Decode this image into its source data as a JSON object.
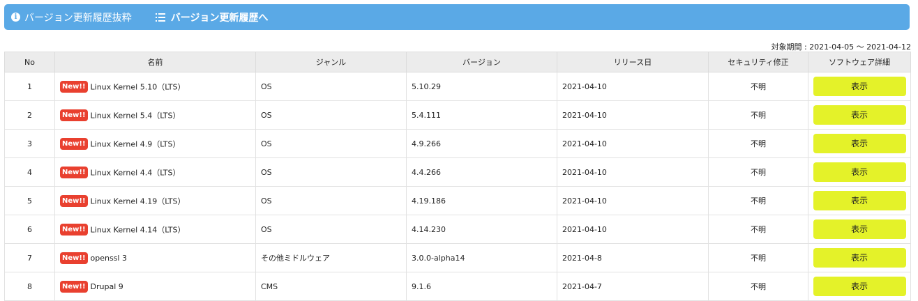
{
  "topbar": {
    "item1": "バージョン更新履歴抜粋",
    "item2": "バージョン更新履歴へ"
  },
  "period": "対象期間 : 2021-04-05 〜 2021-04-12",
  "table": {
    "headers": [
      "No",
      "名前",
      "ジャンル",
      "バージョン",
      "リリース日",
      "セキュリティ修正",
      "ソフトウェア詳細"
    ],
    "rows": [
      {
        "no": "1",
        "badge": "New!!",
        "name": "Linux Kernel 5.10（LTS）",
        "genre": "OS",
        "version": "5.10.29",
        "date": "2021-04-10",
        "security": "不明",
        "button": "表示"
      },
      {
        "no": "2",
        "badge": "New!!",
        "name": "Linux Kernel 5.4（LTS）",
        "genre": "OS",
        "version": "5.4.111",
        "date": "2021-04-10",
        "security": "不明",
        "button": "表示"
      },
      {
        "no": "3",
        "badge": "New!!",
        "name": "Linux Kernel 4.9（LTS）",
        "genre": "OS",
        "version": "4.9.266",
        "date": "2021-04-10",
        "security": "不明",
        "button": "表示"
      },
      {
        "no": "4",
        "badge": "New!!",
        "name": "Linux Kernel 4.4（LTS）",
        "genre": "OS",
        "version": "4.4.266",
        "date": "2021-04-10",
        "security": "不明",
        "button": "表示"
      },
      {
        "no": "5",
        "badge": "New!!",
        "name": "Linux Kernel 4.19（LTS）",
        "genre": "OS",
        "version": "4.19.186",
        "date": "2021-04-10",
        "security": "不明",
        "button": "表示"
      },
      {
        "no": "6",
        "badge": "New!!",
        "name": "Linux Kernel 4.14（LTS）",
        "genre": "OS",
        "version": "4.14.230",
        "date": "2021-04-10",
        "security": "不明",
        "button": "表示"
      },
      {
        "no": "7",
        "badge": "New!!",
        "name": "openssl 3",
        "genre": "その他ミドルウェア",
        "version": "3.0.0-alpha14",
        "date": "2021-04-8",
        "security": "不明",
        "button": "表示"
      },
      {
        "no": "8",
        "badge": "New!!",
        "name": "Drupal 9",
        "genre": "CMS",
        "version": "9.1.6",
        "date": "2021-04-7",
        "security": "不明",
        "button": "表示"
      }
    ]
  },
  "colors": {
    "topbar": "#5aa9e6",
    "badge": "#e9402f",
    "button": "#e4f229"
  },
  "icons": {
    "item1": "info-icon",
    "item2": "list-icon"
  }
}
